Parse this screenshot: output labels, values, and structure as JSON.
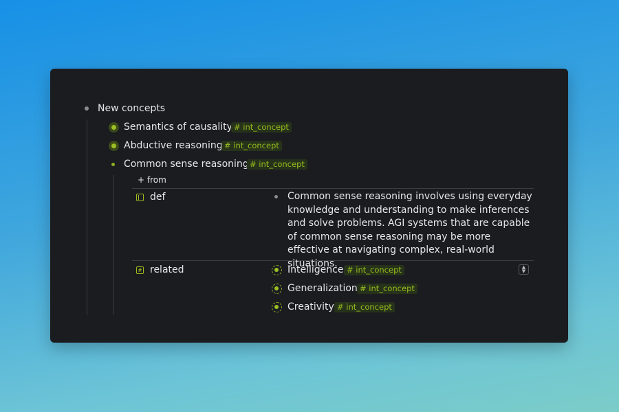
{
  "outline": {
    "root": {
      "label": "New concepts"
    },
    "children": [
      {
        "label": "Semantics of causality",
        "tag": "# int_concept"
      },
      {
        "label": "Abductive reasoning",
        "tag": "# int_concept"
      },
      {
        "label": "Common sense reasoning",
        "tag": "# int_concept",
        "from_label": "+ from",
        "fields": {
          "def": {
            "name": "def",
            "icon": "definition-field-icon",
            "value": "Common sense reasoning involves using everyday knowledge and understanding to make inferences and solve problems. AGI systems that are capable of common sense reasoning may be more effective at navigating complex, real-world situations."
          },
          "related": {
            "name": "related",
            "icon": "hash-field-icon",
            "icon_glyph": "#",
            "items": [
              {
                "label": "Intelligence",
                "tag": "# int_concept"
              },
              {
                "label": "Generalization",
                "tag": "# int_concept"
              },
              {
                "label": "Creativity",
                "tag": "# int_concept"
              }
            ],
            "selector_icon": "chevron-up-down-icon"
          }
        }
      }
    ]
  },
  "colors": {
    "accent": "#9bbb1e",
    "tag_bg": "#26331a",
    "panel_bg": "#1b1c20",
    "text": "#e6e6e8"
  }
}
